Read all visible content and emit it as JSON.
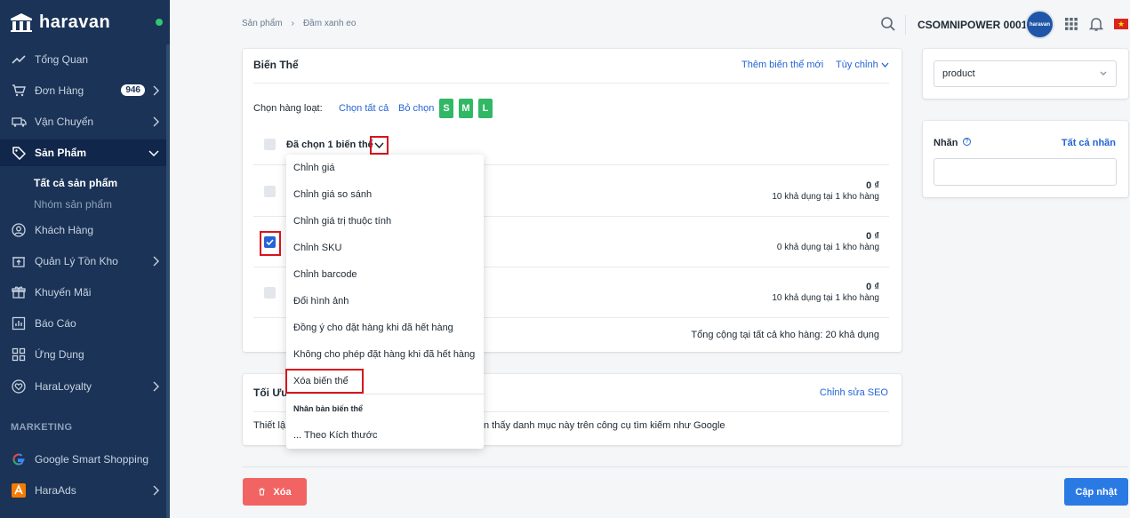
{
  "brand": {
    "name": "haravan"
  },
  "sidebar": {
    "items": [
      {
        "label": "Tổng Quan"
      },
      {
        "label": "Đơn Hàng",
        "badge": "946"
      },
      {
        "label": "Vận Chuyển"
      },
      {
        "label": "Sản Phẩm"
      },
      {
        "label": "Khách Hàng"
      },
      {
        "label": "Quản Lý Tồn Kho"
      },
      {
        "label": "Khuyến Mãi"
      },
      {
        "label": "Báo Cáo"
      },
      {
        "label": "Ứng Dụng"
      },
      {
        "label": "HaraLoyalty"
      },
      {
        "label": "Google Smart Shopping"
      },
      {
        "label": "HaraAds"
      }
    ],
    "sub_items": [
      {
        "label": "Tất cả sản phẩm"
      },
      {
        "label": "Nhóm sản phẩm"
      }
    ],
    "section_marketing": "MARKETING"
  },
  "header": {
    "breadcrumb": [
      "Sản phẩm",
      "Đầm xanh eo"
    ],
    "store_name": "CSOMNIPOWER 0001",
    "avatar_text": "haravan"
  },
  "variants_card": {
    "title": "Biến Thể",
    "add_link": "Thêm biến thể mới",
    "custom_link": "Tùy chỉnh",
    "bulk_label": "Chọn hàng loạt:",
    "select_all": "Chọn tất cả",
    "deselect": "Bỏ chọn",
    "size_chips": [
      "S",
      "M",
      "L"
    ],
    "selected_label": "Đã chọn 1 biến thể",
    "rows": [
      {
        "price": "0 ₫",
        "availability": "10 khả dụng tại 1 kho hàng",
        "checked": false
      },
      {
        "price": "0 ₫",
        "availability": "0 khả dụng tại 1 kho hàng",
        "checked": true
      },
      {
        "price": "0 ₫",
        "availability": "10 khả dụng tại 1 kho hàng",
        "checked": false
      }
    ],
    "total": "Tổng cộng tại tất cả kho hàng: 20 khả dụng"
  },
  "dropdown": {
    "items": [
      "Chỉnh giá",
      "Chỉnh giá so sánh",
      "Chỉnh giá trị thuộc tính",
      "Chỉnh SKU",
      "Chỉnh barcode",
      "Đổi hình ảnh",
      "Đồng ý cho đặt hàng khi đã hết hàng",
      "Không cho phép đặt hàng khi đã hết hàng",
      "Xóa biến thể"
    ],
    "section_header": "Nhân bản biến thể",
    "section_item": "... Theo Kích thước"
  },
  "seo_card": {
    "title": "Tối Ưu",
    "edit_link": "Chỉnh sửa SEO",
    "desc_start": "Thiết lậ",
    "desc_end": "n thấy danh mục này trên công cụ tìm kiếm như Google"
  },
  "type_card": {
    "value": "product"
  },
  "tags_card": {
    "title": "Nhãn",
    "all_link": "Tất cả nhãn"
  },
  "footer": {
    "delete_label": "Xóa",
    "save_label": "Cập nhật"
  }
}
